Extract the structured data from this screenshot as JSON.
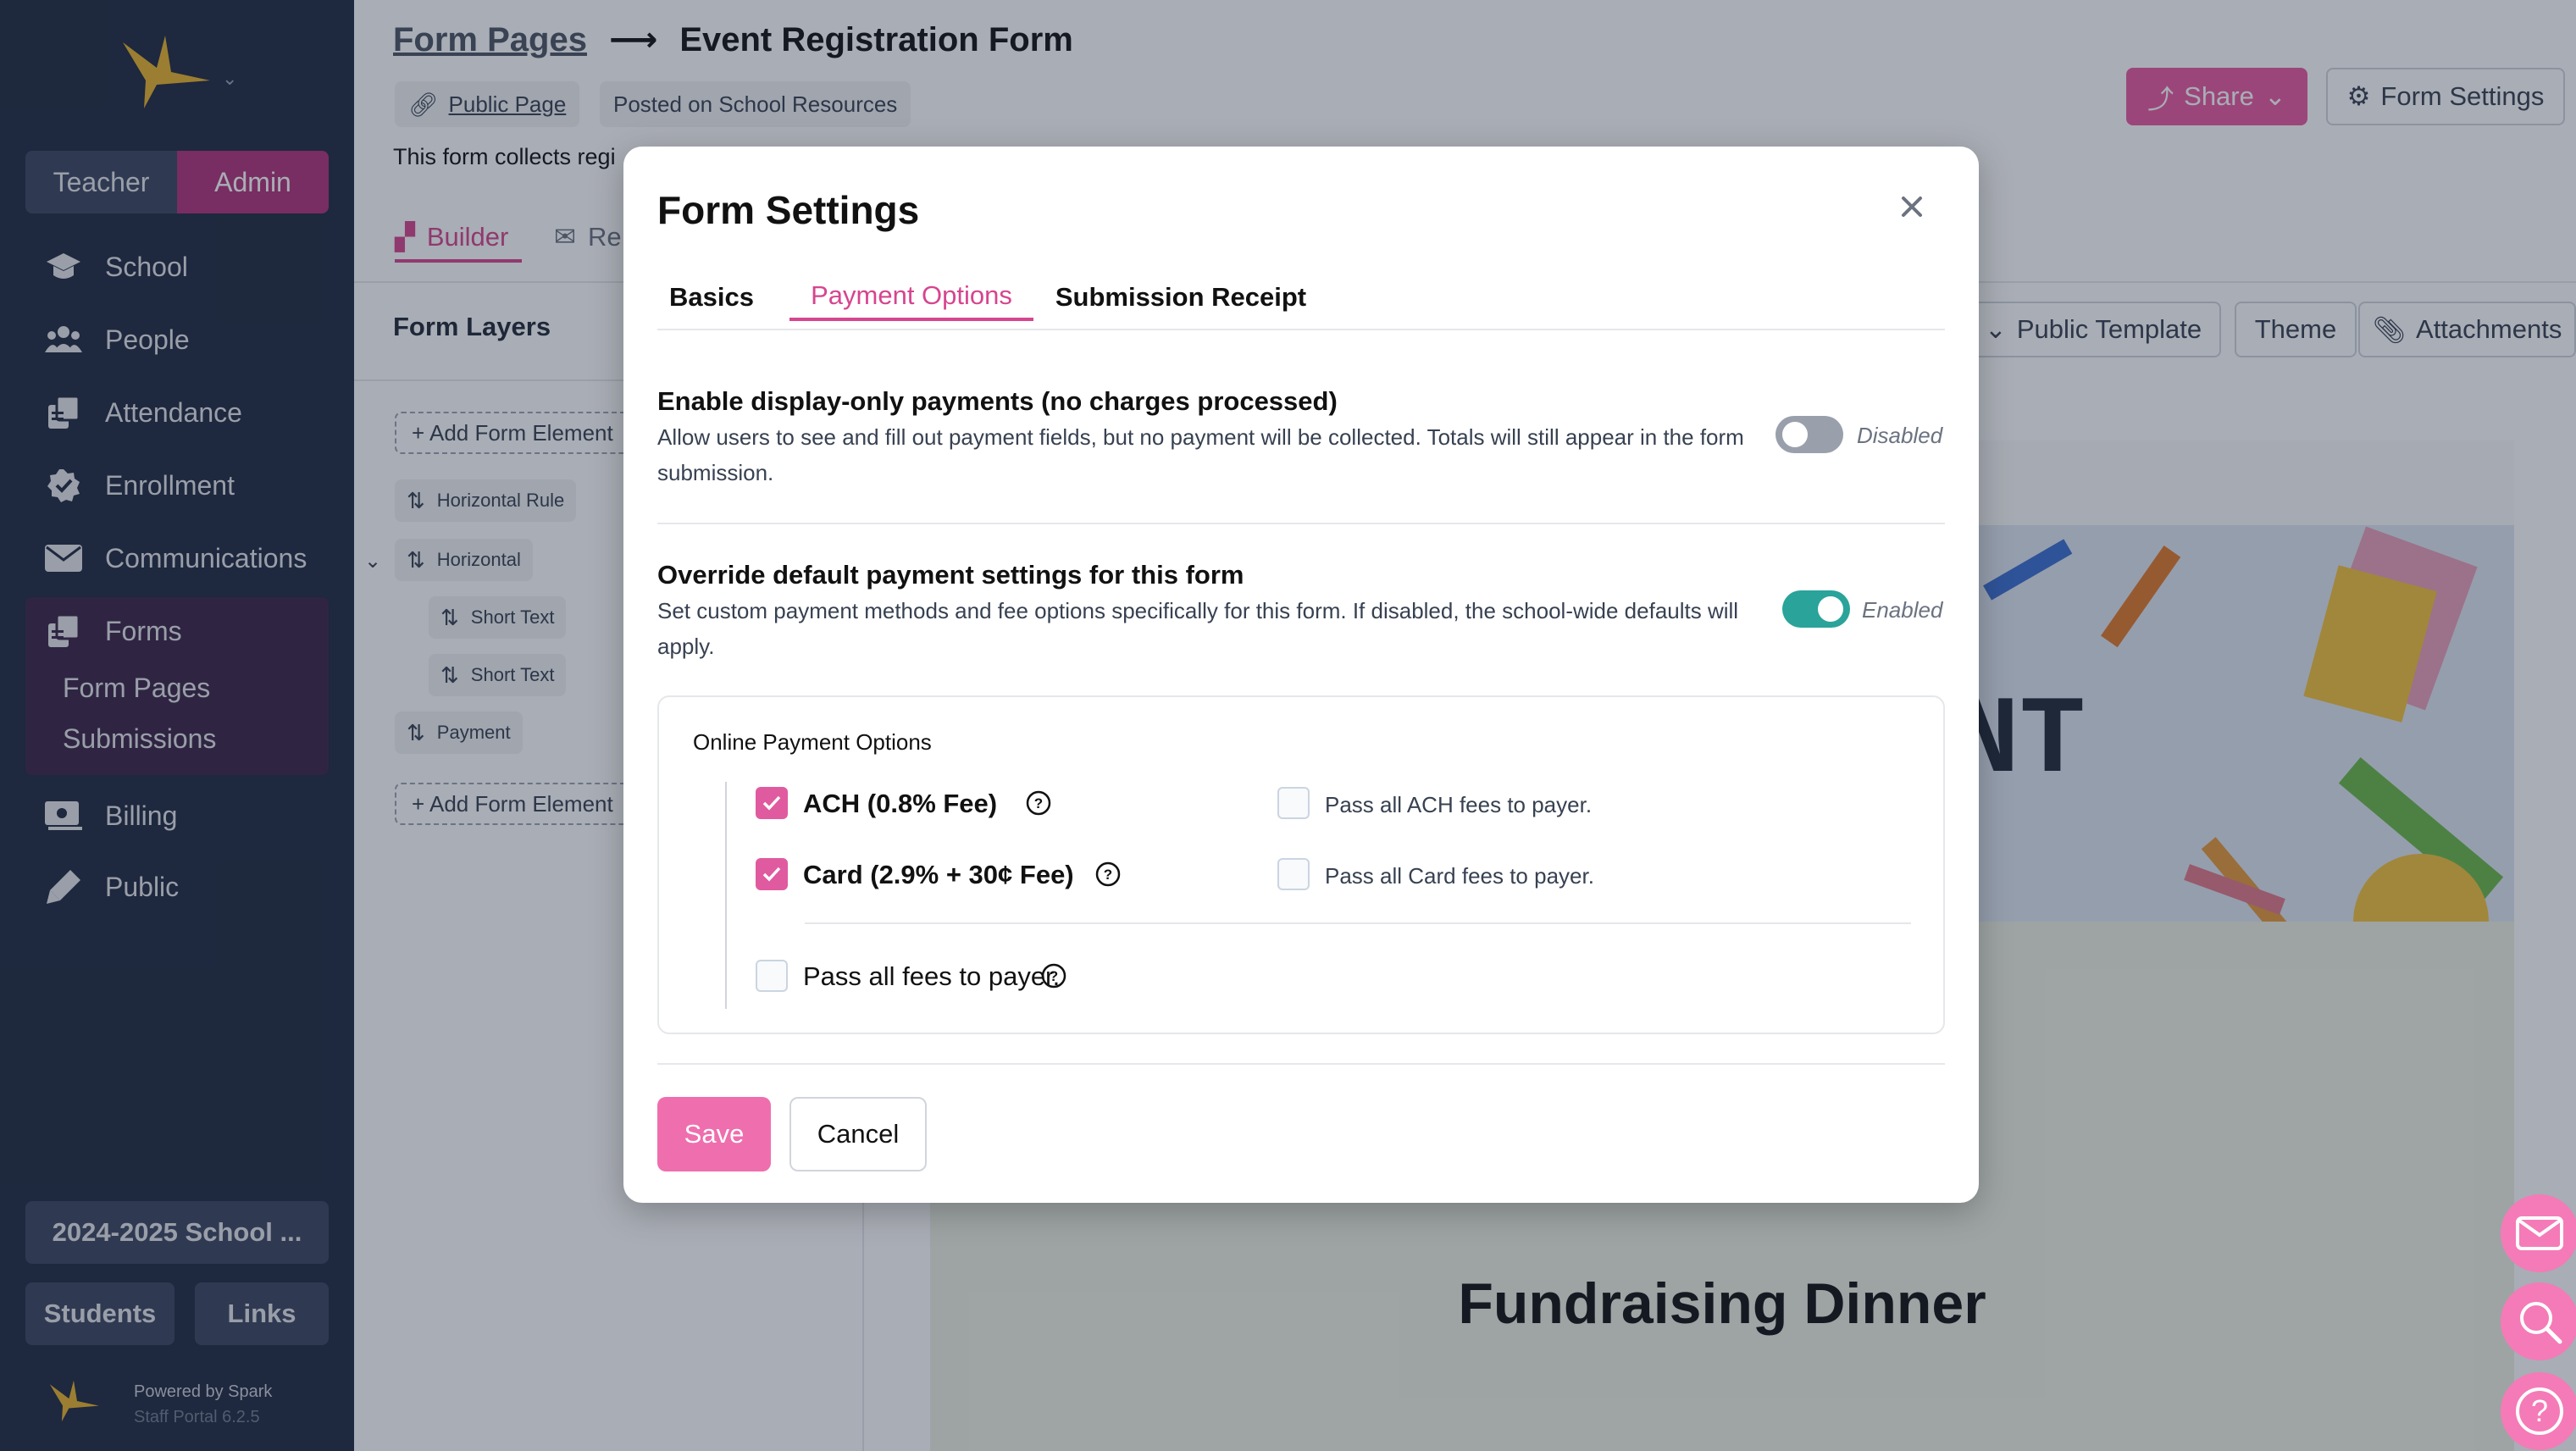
{
  "sidebar": {
    "roles": [
      "Teacher",
      "Admin"
    ],
    "active_role": "Admin",
    "nav": [
      {
        "label": "School",
        "icon": "graduation-cap-icon"
      },
      {
        "label": "People",
        "icon": "people-icon"
      },
      {
        "label": "Attendance",
        "icon": "attendance-icon"
      },
      {
        "label": "Enrollment",
        "icon": "badge-check-icon"
      },
      {
        "label": "Communications",
        "icon": "envelope-icon"
      },
      {
        "label": "Forms",
        "icon": "forms-icon"
      },
      {
        "label": "Billing",
        "icon": "billing-icon"
      },
      {
        "label": "Public",
        "icon": "pen-icon"
      }
    ],
    "forms_sub": [
      "Form Pages",
      "Submissions"
    ],
    "school_year": "2024-2025 School ...",
    "students_button": "Students",
    "links_button": "Links",
    "powered_by": "Powered by Spark",
    "version": "Staff Portal 6.2.5"
  },
  "header": {
    "breadcrumb_parent": "Form Pages",
    "breadcrumb_arrow": "⟶",
    "breadcrumb_current": "Event Registration Form",
    "public_page": "Public Page",
    "posted_on": "Posted on School Resources",
    "description": "This form collects regi",
    "share_label": "Share",
    "form_settings_label": "Form Settings"
  },
  "builder": {
    "tabs": [
      "Builder",
      "Re"
    ],
    "layers_title": "Form Layers",
    "add_element": "+ Add Form Element",
    "layers": [
      "Horizontal Rule",
      "Horizontal",
      "Short Text",
      "Short Text",
      "Payment"
    ],
    "toolbar": [
      "Public Template",
      "Theme",
      "Attachments"
    ],
    "preview_banner_text": "NT",
    "preview_title": "Fundraising Dinner"
  },
  "modal": {
    "title": "Form Settings",
    "tabs": [
      "Basics",
      "Payment Options",
      "Submission Receipt"
    ],
    "active_tab": "Payment Options",
    "display_only": {
      "title": "Enable display-only payments (no charges processed)",
      "desc": "Allow users to see and fill out payment fields, but no payment will be collected. Totals will still appear in the form submission.",
      "state": "Disabled",
      "enabled": false
    },
    "override": {
      "title": "Override default payment settings for this form",
      "desc": "Set custom payment methods and fee options specifically for this form. If disabled, the school-wide defaults will apply.",
      "state": "Enabled",
      "enabled": true
    },
    "online": {
      "title": "Online Payment Options",
      "ach_label": "ACH (0.8% Fee)",
      "ach_checked": true,
      "ach_pass": "Pass all ACH fees to payer.",
      "ach_pass_checked": false,
      "card_label": "Card (2.9% + 30¢ Fee)",
      "card_checked": true,
      "card_pass": "Pass all Card fees to payer.",
      "card_pass_checked": false,
      "all_pass": "Pass all fees to payer.",
      "all_pass_checked": false
    },
    "save": "Save",
    "cancel": "Cancel"
  },
  "colors": {
    "sidebar_bg": "#1f2940",
    "accent_pink": "#e05aa0",
    "toggle_on": "#2aa39a",
    "admin_bg": "#b0327a"
  }
}
